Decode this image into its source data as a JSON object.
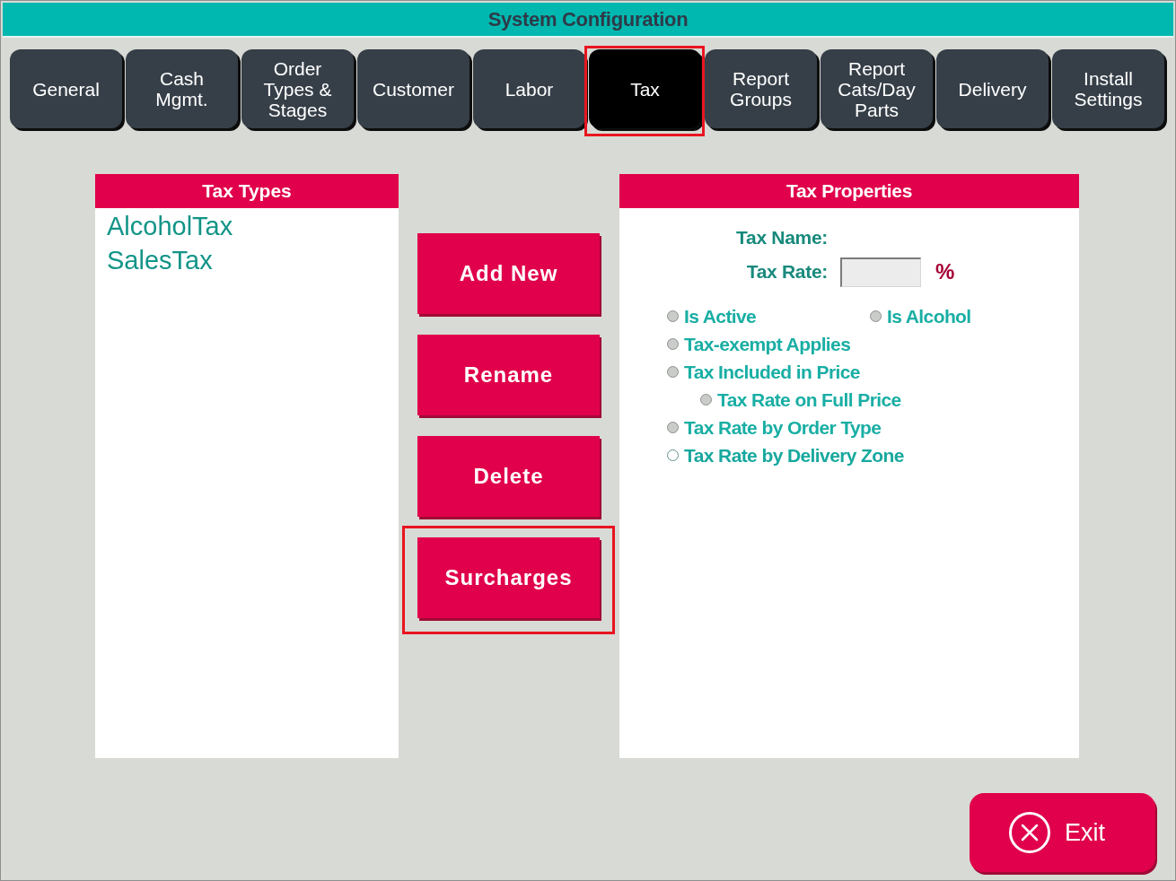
{
  "window": {
    "title": "System Configuration"
  },
  "tabs": [
    {
      "label": "General",
      "selected": false,
      "highlighted": false
    },
    {
      "label": "Cash Mgmt.",
      "selected": false,
      "highlighted": false
    },
    {
      "label": "Order Types & Stages",
      "selected": false,
      "highlighted": false
    },
    {
      "label": "Customer",
      "selected": false,
      "highlighted": false
    },
    {
      "label": "Labor",
      "selected": false,
      "highlighted": false
    },
    {
      "label": "Tax",
      "selected": true,
      "highlighted": true
    },
    {
      "label": "Report Groups",
      "selected": false,
      "highlighted": false
    },
    {
      "label": "Report Cats/Day Parts",
      "selected": false,
      "highlighted": false
    },
    {
      "label": "Delivery",
      "selected": false,
      "highlighted": false
    },
    {
      "label": "Install Settings",
      "selected": false,
      "highlighted": false
    }
  ],
  "tax_types": {
    "title": "Tax Types",
    "items": [
      {
        "label": "AlcoholTax",
        "selected": false
      },
      {
        "label": "SalesTax",
        "selected": false
      }
    ]
  },
  "actions": [
    {
      "label": "Add New",
      "highlighted": false
    },
    {
      "label": "Rename",
      "highlighted": false
    },
    {
      "label": "Delete",
      "highlighted": false
    },
    {
      "label": "Surcharges",
      "highlighted": true
    }
  ],
  "tax_properties": {
    "title": "Tax Properties",
    "tax_name": {
      "label": "Tax Name:"
    },
    "tax_rate": {
      "label": "Tax Rate:",
      "unit": "%"
    },
    "option_rows": [
      {
        "options": [
          {
            "label": "Is Active",
            "checked": false,
            "disabled": true
          },
          {
            "label": "Is Alcohol",
            "checked": false,
            "disabled": true
          }
        ]
      },
      {
        "options": [
          {
            "label": "Tax-exempt Applies",
            "checked": false,
            "disabled": true
          }
        ]
      },
      {
        "options": [
          {
            "label": "Tax Included in Price",
            "checked": false,
            "disabled": true,
            "children": [
              {
                "label": "Tax Rate on Full Price",
                "checked": false,
                "disabled": true
              }
            ]
          }
        ]
      },
      {
        "options": [
          {
            "label": "Tax Rate by Order Type",
            "checked": false,
            "disabled": true
          }
        ]
      },
      {
        "options": [
          {
            "label": "Tax Rate by Delivery Zone",
            "checked": false,
            "disabled": false
          }
        ]
      }
    ]
  },
  "exit_button": {
    "label": "Exit"
  }
}
